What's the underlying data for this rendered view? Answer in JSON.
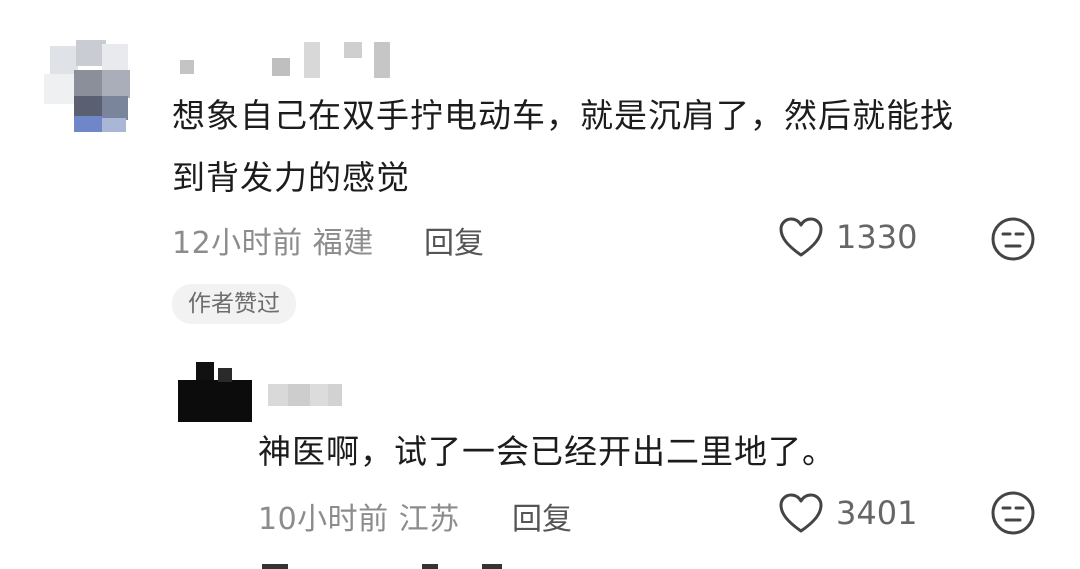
{
  "comments": [
    {
      "text_line1": "想象自己在双手拧电动车，就是沉肩了，然后就能找",
      "text_line2": "到背发力的感觉",
      "time": "12小时前",
      "location": "福建",
      "reply_label": "回复",
      "likes": "1330",
      "badge": "作者赞过"
    }
  ],
  "replies": [
    {
      "text": "神医啊，试了一会已经开出二里地了。",
      "time": "10小时前",
      "location": "江苏",
      "reply_label": "回复",
      "likes": "3401"
    }
  ]
}
